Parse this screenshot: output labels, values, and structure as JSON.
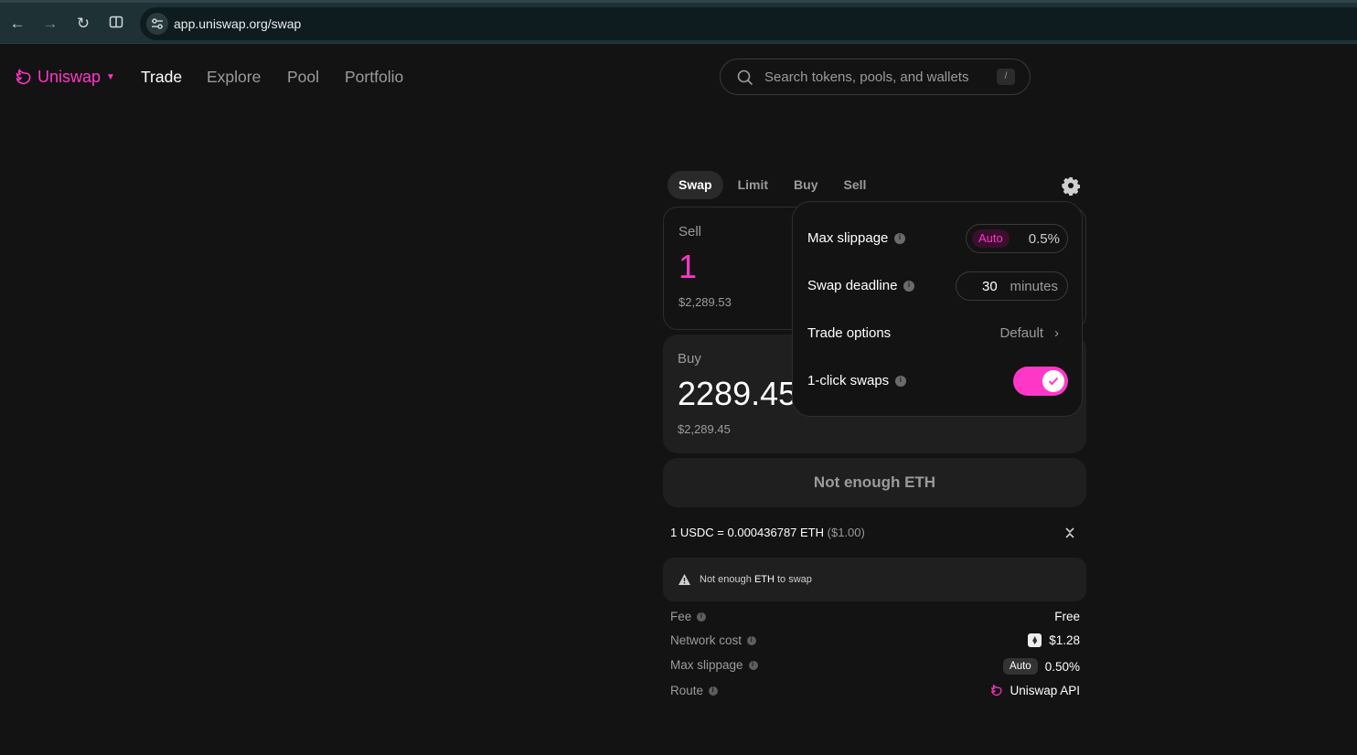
{
  "browser": {
    "url": "app.uniswap.org/swap"
  },
  "nav": {
    "brand": "Uniswap",
    "links": [
      "Trade",
      "Explore",
      "Pool",
      "Portfolio"
    ],
    "active": "Trade",
    "search_placeholder": "Search tokens, pools, and wallets",
    "search_shortcut": "/"
  },
  "swap": {
    "tabs": [
      "Swap",
      "Limit",
      "Buy",
      "Sell"
    ],
    "active_tab": "Swap",
    "sell": {
      "label": "Sell",
      "amount": "1",
      "usd": "$2,289.53"
    },
    "buy": {
      "label": "Buy",
      "amount": "2289.45",
      "usd": "$2,289.45"
    },
    "cta_label": "Not enough ETH",
    "rate": "1 USDC = 0.000436787 ETH",
    "rate_usd": "($1.00)",
    "warning": {
      "prefix": "Not enough ",
      "token": "ETH",
      "suffix": " to swap"
    },
    "details": {
      "fee_label": "Fee",
      "fee_value": "Free",
      "network_label": "Network cost",
      "network_value": "$1.28",
      "slippage_label": "Max slippage",
      "slippage_badge": "Auto",
      "slippage_value": "0.50%",
      "route_label": "Route",
      "route_value": "Uniswap API"
    }
  },
  "settings": {
    "max_slippage_label": "Max slippage",
    "max_slippage_auto": "Auto",
    "max_slippage_value": "0.5%",
    "deadline_label": "Swap deadline",
    "deadline_value": "30",
    "deadline_unit": "minutes",
    "trade_options_label": "Trade options",
    "trade_options_value": "Default",
    "one_click_label": "1-click swaps",
    "one_click_enabled": true
  },
  "colors": {
    "accent": "#ff37c7",
    "background": "#131313",
    "surface": "#1f1f1f",
    "browser_bar": "#1e3135"
  }
}
